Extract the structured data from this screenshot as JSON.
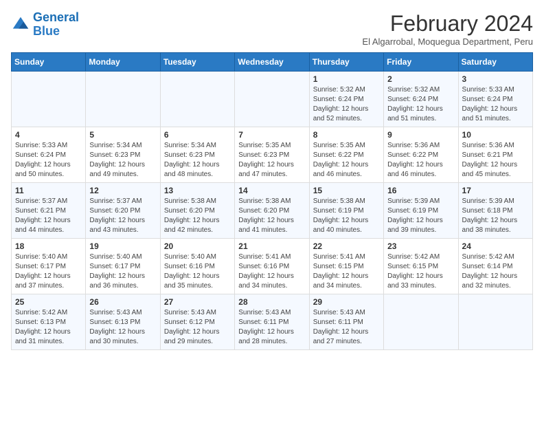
{
  "header": {
    "logo_line1": "General",
    "logo_line2": "Blue",
    "month_year": "February 2024",
    "location": "El Algarrobal, Moquegua Department, Peru"
  },
  "days_of_week": [
    "Sunday",
    "Monday",
    "Tuesday",
    "Wednesday",
    "Thursday",
    "Friday",
    "Saturday"
  ],
  "weeks": [
    [
      {
        "day": "",
        "info": ""
      },
      {
        "day": "",
        "info": ""
      },
      {
        "day": "",
        "info": ""
      },
      {
        "day": "",
        "info": ""
      },
      {
        "day": "1",
        "info": "Sunrise: 5:32 AM\nSunset: 6:24 PM\nDaylight: 12 hours\nand 52 minutes."
      },
      {
        "day": "2",
        "info": "Sunrise: 5:32 AM\nSunset: 6:24 PM\nDaylight: 12 hours\nand 51 minutes."
      },
      {
        "day": "3",
        "info": "Sunrise: 5:33 AM\nSunset: 6:24 PM\nDaylight: 12 hours\nand 51 minutes."
      }
    ],
    [
      {
        "day": "4",
        "info": "Sunrise: 5:33 AM\nSunset: 6:24 PM\nDaylight: 12 hours\nand 50 minutes."
      },
      {
        "day": "5",
        "info": "Sunrise: 5:34 AM\nSunset: 6:23 PM\nDaylight: 12 hours\nand 49 minutes."
      },
      {
        "day": "6",
        "info": "Sunrise: 5:34 AM\nSunset: 6:23 PM\nDaylight: 12 hours\nand 48 minutes."
      },
      {
        "day": "7",
        "info": "Sunrise: 5:35 AM\nSunset: 6:23 PM\nDaylight: 12 hours\nand 47 minutes."
      },
      {
        "day": "8",
        "info": "Sunrise: 5:35 AM\nSunset: 6:22 PM\nDaylight: 12 hours\nand 46 minutes."
      },
      {
        "day": "9",
        "info": "Sunrise: 5:36 AM\nSunset: 6:22 PM\nDaylight: 12 hours\nand 46 minutes."
      },
      {
        "day": "10",
        "info": "Sunrise: 5:36 AM\nSunset: 6:21 PM\nDaylight: 12 hours\nand 45 minutes."
      }
    ],
    [
      {
        "day": "11",
        "info": "Sunrise: 5:37 AM\nSunset: 6:21 PM\nDaylight: 12 hours\nand 44 minutes."
      },
      {
        "day": "12",
        "info": "Sunrise: 5:37 AM\nSunset: 6:20 PM\nDaylight: 12 hours\nand 43 minutes."
      },
      {
        "day": "13",
        "info": "Sunrise: 5:38 AM\nSunset: 6:20 PM\nDaylight: 12 hours\nand 42 minutes."
      },
      {
        "day": "14",
        "info": "Sunrise: 5:38 AM\nSunset: 6:20 PM\nDaylight: 12 hours\nand 41 minutes."
      },
      {
        "day": "15",
        "info": "Sunrise: 5:38 AM\nSunset: 6:19 PM\nDaylight: 12 hours\nand 40 minutes."
      },
      {
        "day": "16",
        "info": "Sunrise: 5:39 AM\nSunset: 6:19 PM\nDaylight: 12 hours\nand 39 minutes."
      },
      {
        "day": "17",
        "info": "Sunrise: 5:39 AM\nSunset: 6:18 PM\nDaylight: 12 hours\nand 38 minutes."
      }
    ],
    [
      {
        "day": "18",
        "info": "Sunrise: 5:40 AM\nSunset: 6:17 PM\nDaylight: 12 hours\nand 37 minutes."
      },
      {
        "day": "19",
        "info": "Sunrise: 5:40 AM\nSunset: 6:17 PM\nDaylight: 12 hours\nand 36 minutes."
      },
      {
        "day": "20",
        "info": "Sunrise: 5:40 AM\nSunset: 6:16 PM\nDaylight: 12 hours\nand 35 minutes."
      },
      {
        "day": "21",
        "info": "Sunrise: 5:41 AM\nSunset: 6:16 PM\nDaylight: 12 hours\nand 34 minutes."
      },
      {
        "day": "22",
        "info": "Sunrise: 5:41 AM\nSunset: 6:15 PM\nDaylight: 12 hours\nand 34 minutes."
      },
      {
        "day": "23",
        "info": "Sunrise: 5:42 AM\nSunset: 6:15 PM\nDaylight: 12 hours\nand 33 minutes."
      },
      {
        "day": "24",
        "info": "Sunrise: 5:42 AM\nSunset: 6:14 PM\nDaylight: 12 hours\nand 32 minutes."
      }
    ],
    [
      {
        "day": "25",
        "info": "Sunrise: 5:42 AM\nSunset: 6:13 PM\nDaylight: 12 hours\nand 31 minutes."
      },
      {
        "day": "26",
        "info": "Sunrise: 5:43 AM\nSunset: 6:13 PM\nDaylight: 12 hours\nand 30 minutes."
      },
      {
        "day": "27",
        "info": "Sunrise: 5:43 AM\nSunset: 6:12 PM\nDaylight: 12 hours\nand 29 minutes."
      },
      {
        "day": "28",
        "info": "Sunrise: 5:43 AM\nSunset: 6:11 PM\nDaylight: 12 hours\nand 28 minutes."
      },
      {
        "day": "29",
        "info": "Sunrise: 5:43 AM\nSunset: 6:11 PM\nDaylight: 12 hours\nand 27 minutes."
      },
      {
        "day": "",
        "info": ""
      },
      {
        "day": "",
        "info": ""
      }
    ]
  ]
}
